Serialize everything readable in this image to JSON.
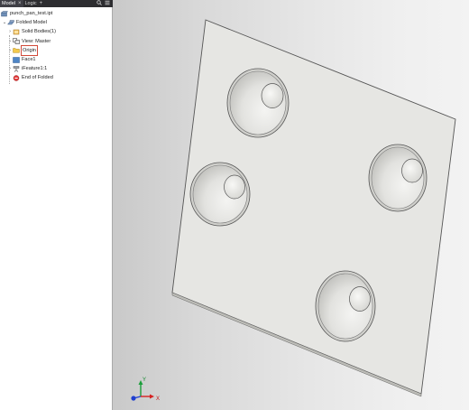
{
  "tabs": {
    "model_label": "Model",
    "logic_label": "Logic",
    "close_glyph": "×",
    "add_glyph": "+"
  },
  "tree": {
    "root": "punch_pan_test.ipt",
    "items": [
      {
        "label": "Folded Model",
        "icon": "folded-model-icon"
      },
      {
        "label": "Solid Bodies(1)",
        "icon": "solid-bodies-icon"
      },
      {
        "label": "View: Master",
        "icon": "view-icon"
      },
      {
        "label": "Origin",
        "icon": "folder-icon"
      },
      {
        "label": "Face1",
        "icon": "face-icon"
      },
      {
        "label": "iFeature1:1",
        "icon": "ifeature-icon"
      },
      {
        "label": "End of Folded",
        "icon": "end-of-part-icon"
      }
    ]
  },
  "colors": {
    "panel_tabbar": "#2d2d30",
    "plate_face": "#e6e6e3",
    "highlight_box": "#d24a3a",
    "axis_x": "#d62020",
    "axis_y": "#1b9e3a",
    "axis_z": "#1f3fd0"
  },
  "viewcube": {
    "x_label": "X",
    "y_label": "Y"
  }
}
